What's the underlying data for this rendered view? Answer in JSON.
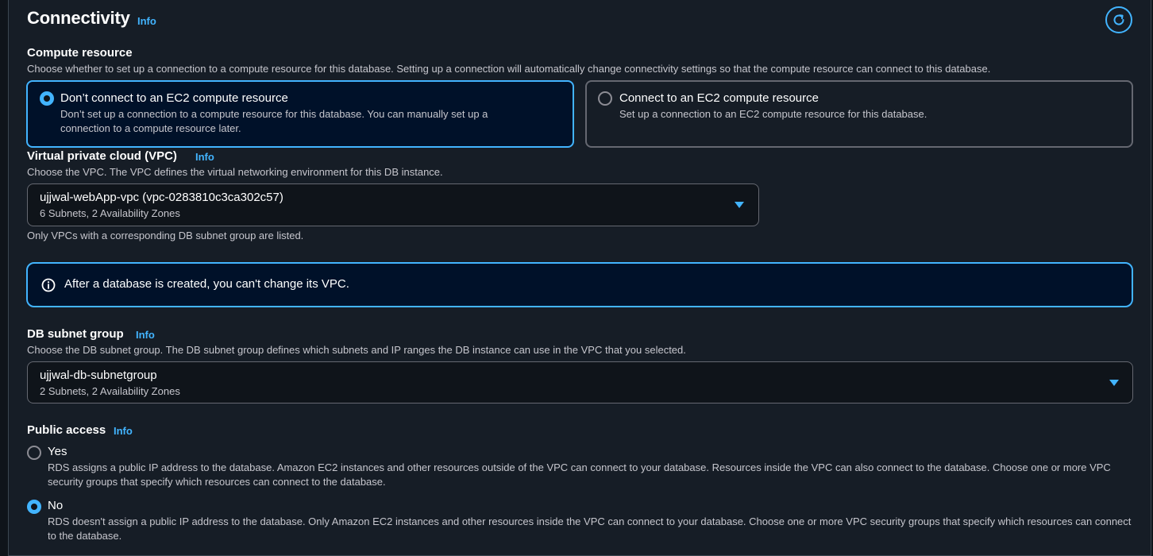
{
  "section": {
    "title": "Connectivity",
    "info_label": "Info"
  },
  "compute": {
    "label": "Compute resource",
    "description": "Choose whether to set up a connection to a compute resource for this database. Setting up a connection will automatically change connectivity settings so that the compute resource can connect to this database.",
    "options": [
      {
        "title": "Don’t connect to an EC2 compute resource",
        "description": "Don’t set up a connection to a compute resource for this database. You can manually set up a connection to a compute resource later.",
        "selected": true
      },
      {
        "title": "Connect to an EC2 compute resource",
        "description": "Set up a connection to an EC2 compute resource for this database.",
        "selected": false
      }
    ]
  },
  "vpc": {
    "label": "Virtual private cloud (VPC)",
    "info_label": "Info",
    "description": "Choose the VPC. The VPC defines the virtual networking environment for this DB instance.",
    "selected_value": "ujjwal-webApp-vpc (vpc-0283810c3ca302c57)",
    "selected_detail": "6 Subnets, 2 Availability Zones",
    "hint": "Only VPCs with a corresponding DB subnet group are listed."
  },
  "alert": {
    "text": "After a database is created, you can't change its VPC."
  },
  "subnet": {
    "label": "DB subnet group",
    "info_label": "Info",
    "description": "Choose the DB subnet group. The DB subnet group defines which subnets and IP ranges the DB instance can use in the VPC that you selected.",
    "selected_value": "ujjwal-db-subnetgroup",
    "selected_detail": "2 Subnets, 2 Availability Zones"
  },
  "public_access": {
    "label": "Public access",
    "info_label": "Info",
    "options": [
      {
        "title": "Yes",
        "description": "RDS assigns a public IP address to the database. Amazon EC2 instances and other resources outside of the VPC can connect to your database. Resources inside the VPC can also connect to the database. Choose one or more VPC security groups that specify which resources can connect to the database.",
        "selected": false
      },
      {
        "title": "No",
        "description": "RDS doesn't assign a public IP address to the database. Only Amazon EC2 instances and other resources inside the VPC can connect to your database. Choose one or more VPC security groups that specify which resources can connect to the database.",
        "selected": true
      }
    ]
  },
  "colors": {
    "accent": "#42b4ff",
    "background": "#161d26",
    "selected_tile": "#001129"
  }
}
